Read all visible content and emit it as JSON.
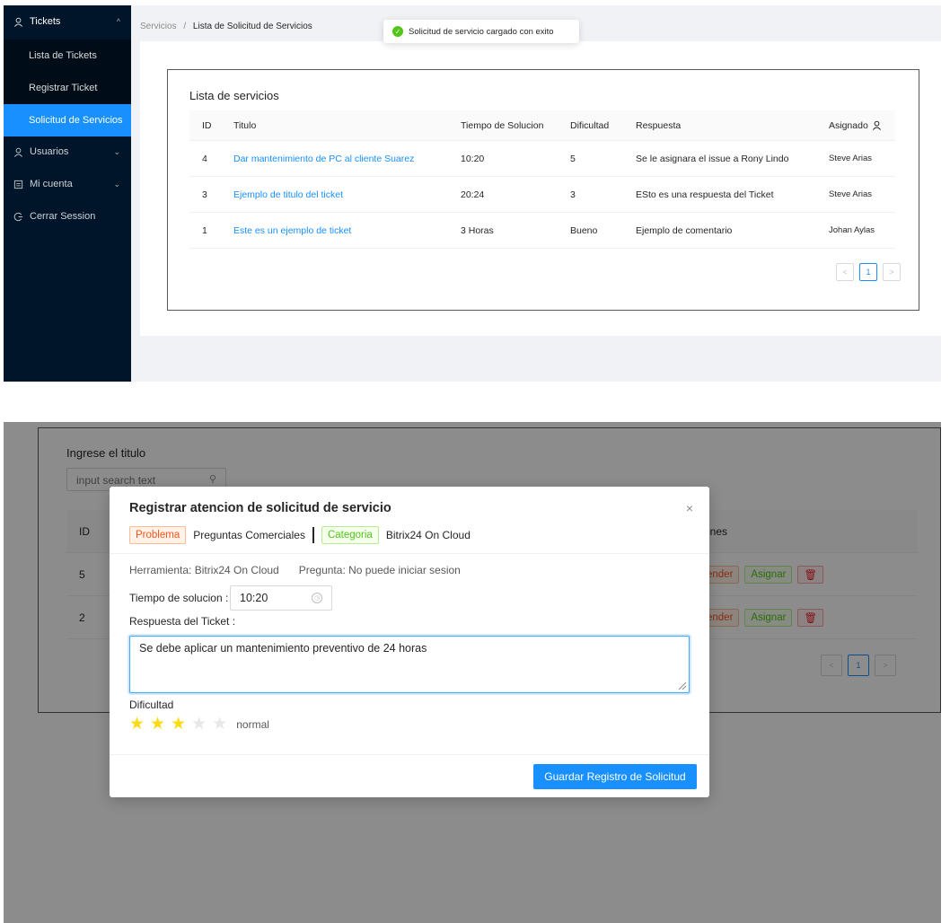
{
  "sidebar": {
    "menu": [
      {
        "label": "Tickets",
        "icon": "user-icon",
        "expanded": true
      },
      {
        "label": "Usuarios",
        "icon": "user-icon"
      },
      {
        "label": "Mi cuenta",
        "icon": "calendar-icon"
      },
      {
        "label": "Cerrar Session",
        "icon": "logout-icon"
      }
    ],
    "submenu": [
      "Lista de Tickets",
      "Registrar Ticket",
      "Solicitud de Servicios"
    ],
    "active_submenu": "Solicitud de Servicios"
  },
  "breadcrumb": {
    "root": "Servicios",
    "separator": "/",
    "current": "Lista de Solicitud de Servicios"
  },
  "toast": {
    "message": "Solicitud de servicio cargado con exito"
  },
  "services": {
    "title": "Lista de servicios",
    "columns": [
      "ID",
      "Titulo",
      "Tiempo de Solucion",
      "Dificultad",
      "Respuesta",
      "Asignado"
    ],
    "rows": [
      {
        "id": "4",
        "titulo": "Dar mantenimiento de PC al cliente Suarez",
        "tiempo": "10:20",
        "dificultad": "5",
        "respuesta": "Se le asignara el issue a Rony Lindo",
        "asignado": "Steve Arias"
      },
      {
        "id": "3",
        "titulo": "Ejemplo de titulo del ticket",
        "tiempo": "20:24",
        "dificultad": "3",
        "respuesta": "ESto es una respuesta del Ticket",
        "asignado": "Steve Arias"
      },
      {
        "id": "1",
        "titulo": "Este es un ejemplo de ticket",
        "tiempo": "3 Horas",
        "dificultad": "Bueno",
        "respuesta": "Ejemplo de comentario",
        "asignado": "Johan Aylas"
      }
    ],
    "pagination": {
      "prev": "<",
      "current": "1",
      "next": ">"
    }
  },
  "background_list": {
    "search_label": "Ingrese el titulo",
    "search_placeholder": "input search text",
    "col_id": "ID",
    "col_actions_partial": "ones",
    "rows": [
      {
        "id": "5",
        "atender_partial": "ender",
        "asignar": "Asignar"
      },
      {
        "id": "2",
        "atender_partial": "ender",
        "asignar": "Asignar"
      }
    ],
    "pagination": {
      "prev": "<",
      "current": "1",
      "next": ">"
    }
  },
  "modal": {
    "title": "Registrar atencion de solicitud de servicio",
    "close": "×",
    "tag_problema": "Problema",
    "problema_value": "Preguntas Comerciales",
    "tag_categoria": "Categoria",
    "categoria_value": "Bitrix24 On Cloud",
    "herramienta": "Herramienta: Bitrix24 On Cloud",
    "pregunta": "Pregunta: No puede iniciar sesion",
    "tiempo_label": "Tiempo de solucion :",
    "tiempo_value": "10:20",
    "respuesta_label": "Respuesta del Ticket :",
    "respuesta_value": "Se debe aplicar un mantenimiento preventivo de 24 horas",
    "dificultad_label": "Dificultad",
    "rating": 3,
    "rating_max": 5,
    "rating_text": "normal",
    "save_label": "Guardar Registro de Solicitud"
  },
  "colors": {
    "primary": "#1890ff",
    "sidebar": "#001529",
    "star": "#fadb14"
  }
}
